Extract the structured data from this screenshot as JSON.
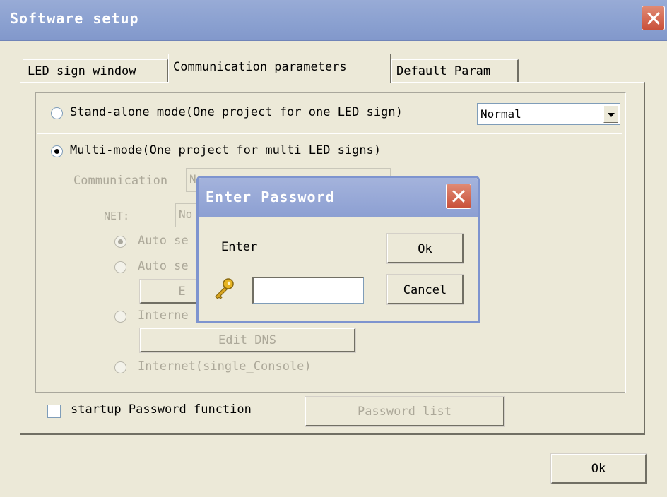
{
  "window": {
    "title": "Software setup",
    "ok_label": "Ok"
  },
  "tabs": [
    {
      "label": "LED sign window",
      "active": false
    },
    {
      "label": "Communication parameters",
      "active": true
    },
    {
      "label": "Default Param",
      "active": false
    }
  ],
  "modes": {
    "standalone_label": "Stand-alone mode(One project for one LED sign)",
    "standalone_selected": false,
    "standalone_combo_value": "Normal",
    "multi_label": "Multi-mode(One project for multi LED signs)",
    "multi_selected": true
  },
  "multi_options": {
    "communication_label": "Communication",
    "communication_value": "N",
    "net_label": "NET:",
    "net_value": "No",
    "auto_se_1": "Auto se",
    "auto_se_2": "Auto se",
    "edit_btn_partial": "E",
    "internet_partial": "Interne",
    "edit_dns_label": "Edit DNS",
    "internet_single": "Internet(single_Console)"
  },
  "password": {
    "startup_label": "startup Password function",
    "startup_checked": false,
    "list_button_label": "Password list"
  },
  "password_dialog": {
    "title": "Enter Password",
    "prompt": "Enter",
    "input_value": "",
    "ok_label": "Ok",
    "cancel_label": "Cancel",
    "key_icon": "key-icon"
  },
  "colors": {
    "window_bg": "#ece9d8",
    "titlebar": "#8aa0d0",
    "close_button": "#c9503a",
    "disabled_text": "#aca899"
  }
}
